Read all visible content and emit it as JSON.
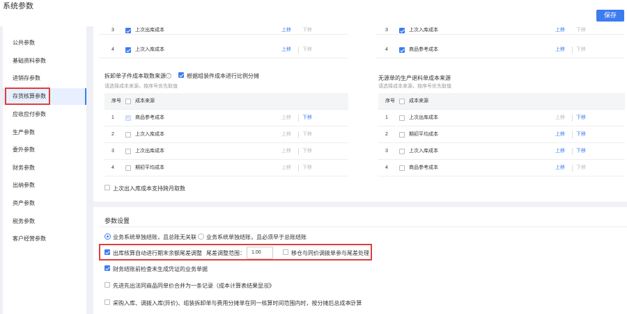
{
  "window": {
    "title": "系统参数"
  },
  "toolbar": {
    "save_label": "保存"
  },
  "sidebar": {
    "items": [
      {
        "label": "公共参数"
      },
      {
        "label": "基础资料参数"
      },
      {
        "label": "进销存参数"
      },
      {
        "label": "存货核算参数"
      },
      {
        "label": "应收应付参数"
      },
      {
        "label": "生产参数"
      },
      {
        "label": "委外参数"
      },
      {
        "label": "财务参数"
      },
      {
        "label": "出纳参数"
      },
      {
        "label": "资产参数"
      },
      {
        "label": "税务参数"
      },
      {
        "label": "客户经营参数"
      }
    ]
  },
  "table_top_left": [
    {
      "no": "3",
      "source": "上次出库成本",
      "up": "上移",
      "down": "下移"
    },
    {
      "no": "4",
      "source": "上次入库成本",
      "up": "上移",
      "down": "下移"
    }
  ],
  "table_top_right": [
    {
      "no": "3",
      "source": "上次入库成本",
      "up": "上移",
      "down": "下移"
    },
    {
      "no": "4",
      "source": "商品参考成本",
      "up": "上移",
      "down": "下移"
    }
  ],
  "split": {
    "title": "拆卸单子件成本取数来源",
    "check_label": "根据组装件成本进行比例分摊",
    "hint": "请选择成本来源，按序号优先取值"
  },
  "returns": {
    "title": "无源单的生产退料单成本来源",
    "hint": "请选择成本来源，按序号优先取值"
  },
  "table_headers": {
    "no": "序号",
    "source": "成本来源"
  },
  "left_rows": [
    {
      "no": "1",
      "source": "商品参考成本",
      "up": "上移",
      "down": "下移"
    },
    {
      "no": "2",
      "source": "上次入库成本",
      "up": "上移",
      "down": "下移"
    },
    {
      "no": "3",
      "source": "上次出库成本",
      "up": "上移",
      "down": "下移"
    },
    {
      "no": "4",
      "source": "期初平均成本",
      "up": "上移",
      "down": "下移"
    }
  ],
  "right_rows": [
    {
      "no": "1",
      "source": "上次出库成本",
      "up": "上移",
      "down": "下移"
    },
    {
      "no": "2",
      "source": "期初平均成本",
      "up": "上移",
      "down": "下移"
    },
    {
      "no": "3",
      "source": "上次入库成本",
      "up": "上移",
      "down": "下移"
    },
    {
      "no": "4",
      "source": "商品参考成本",
      "up": "上移",
      "down": "下移"
    }
  ],
  "cross_month": "上次出入库成本支持跨月取数",
  "params": {
    "title": "参数设置",
    "radio1": "业务系统单独结账，且总账无关联",
    "radio2": "业务系统单独结账，且必须早于总账结账",
    "tail_check": "出库核算自动进行期末余额尾差调整",
    "tail_range_label": "尾差调整范围：",
    "tail_range_value": "1.00",
    "transfer_check": "移仓与同价调拨单参与尾差处理",
    "voucher_check": "财务结账前检查未生成凭证的业务单据",
    "fifo_check": "先进先出法同商品同单价合并为一条记录（成本计算表结果显示）",
    "purchase_check": "采购入库、调拨入库(异价)、组装拆卸单与费用分摊单在同一核算时间范围内时，按分摊后总成本计算"
  }
}
